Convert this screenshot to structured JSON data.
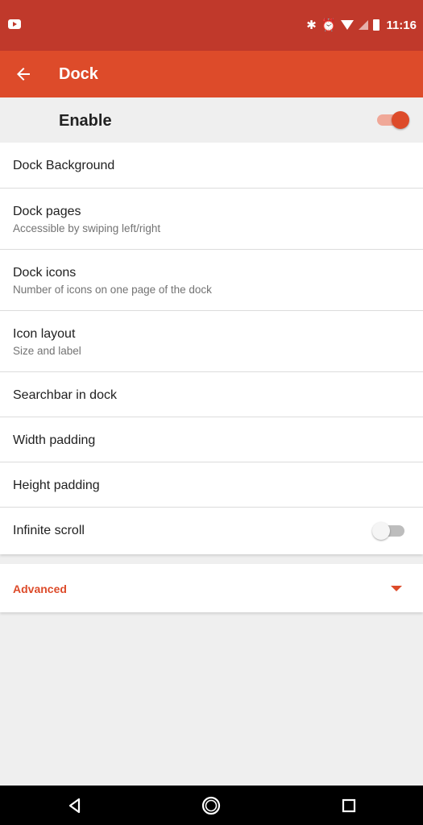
{
  "status_bar": {
    "time": "11:16",
    "icons": [
      "youtube-notification-icon",
      "bluetooth-icon",
      "alarm-icon",
      "wifi-icon",
      "signal-icon",
      "battery-icon"
    ]
  },
  "app_bar": {
    "title": "Dock",
    "back_icon": "arrow-left-icon"
  },
  "enable": {
    "label": "Enable",
    "checked": true
  },
  "items": [
    {
      "title": "Dock Background",
      "subtitle": ""
    },
    {
      "title": "Dock pages",
      "subtitle": "Accessible by swiping left/right"
    },
    {
      "title": "Dock icons",
      "subtitle": "Number of icons on one page of the dock"
    },
    {
      "title": "Icon layout",
      "subtitle": "Size and label"
    },
    {
      "title": "Searchbar in dock",
      "subtitle": ""
    },
    {
      "title": "Width padding",
      "subtitle": ""
    },
    {
      "title": "Height padding",
      "subtitle": ""
    },
    {
      "title": "Infinite scroll",
      "subtitle": "",
      "toggle": false
    }
  ],
  "advanced": {
    "label": "Advanced"
  },
  "colors": {
    "status_bar": "#c0392b",
    "accent": "#dd4b2a",
    "background": "#efefef"
  }
}
